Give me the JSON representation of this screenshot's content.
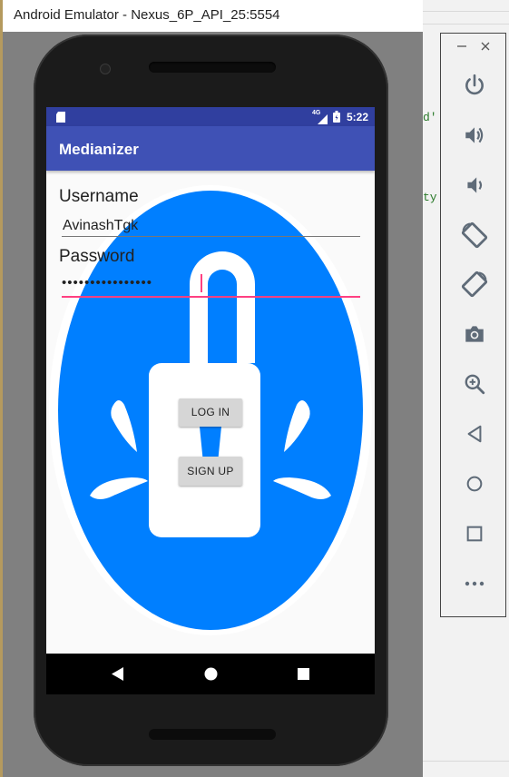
{
  "window": {
    "title": "Android Emulator - Nexus_6P_API_25:5554"
  },
  "ide_background": {
    "code_fragments": [
      "d'",
      "ty"
    ]
  },
  "status_bar": {
    "network": "4G",
    "time": "5:22",
    "icons": [
      "sd-card-icon",
      "signal-icon",
      "battery-icon"
    ]
  },
  "app_bar": {
    "title": "Medianizer"
  },
  "login_form": {
    "username_label": "Username",
    "username_value": "AvinashTgk",
    "password_label": "Password",
    "password_value": "••••••••••••••••",
    "login_button": "LOG IN",
    "signup_button": "SIGN UP"
  },
  "background_art": {
    "icon": "padlock-icon",
    "ellipse_color": "#007FFF",
    "ring_color": "#FFFFFF"
  },
  "colors": {
    "status_bar": "#303F9F",
    "app_bar": "#3F51B5",
    "accent": "#FF4081"
  },
  "nav_bar": {
    "buttons": [
      "back-icon",
      "home-icon",
      "recents-icon"
    ]
  },
  "side_panel": {
    "controls": [
      "minimize-icon",
      "close-icon",
      "power-icon",
      "volume-up-icon",
      "volume-down-icon",
      "rotate-left-icon",
      "rotate-right-icon",
      "camera-icon",
      "zoom-icon",
      "back-icon",
      "home-icon",
      "overview-icon",
      "more-icon"
    ]
  }
}
